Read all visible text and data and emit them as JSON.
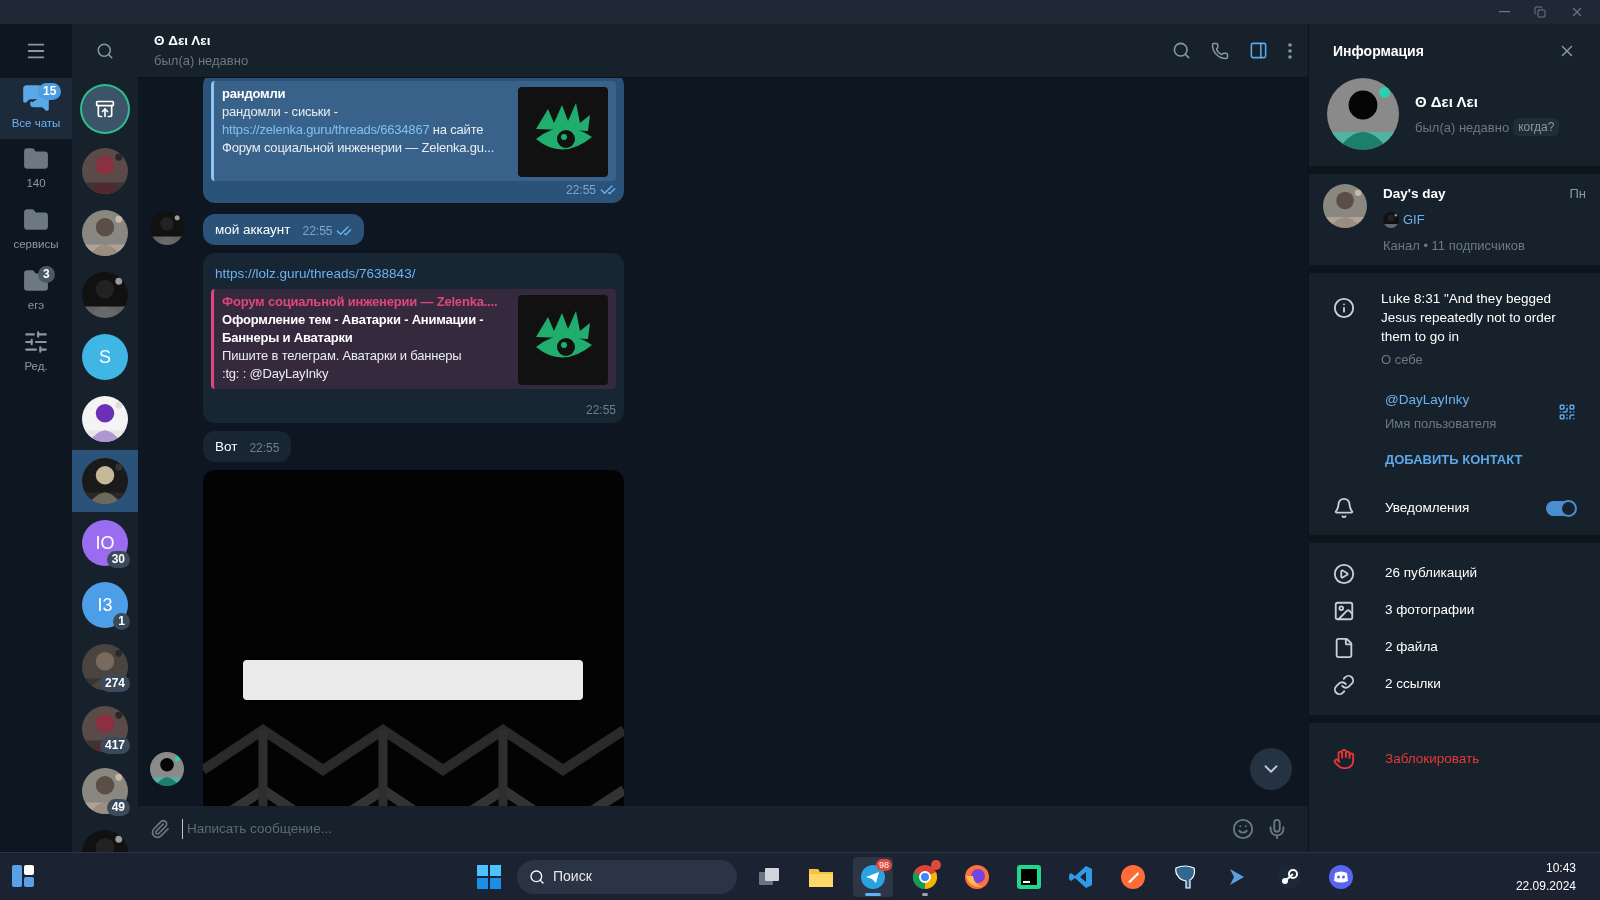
{
  "folders": [
    {
      "kind": "chats",
      "label": "Все чаты",
      "badge": "15",
      "selected": true
    },
    {
      "kind": "folder",
      "label": "140",
      "selected": false
    },
    {
      "kind": "folder",
      "label": "сервисы",
      "selected": false
    },
    {
      "kind": "folder",
      "label": "егэ",
      "badge": "3",
      "selected": false
    },
    {
      "kind": "edit",
      "label": "Ред.",
      "selected": false
    }
  ],
  "chats": [
    {
      "kind": "archive",
      "selected": false
    },
    {
      "kind": "picture",
      "selected": false
    },
    {
      "kind": "picture",
      "selected": false
    },
    {
      "kind": "picture",
      "selected": false
    },
    {
      "kind": "letter",
      "letter": "S",
      "color": "#3fb6e3",
      "selected": false
    },
    {
      "kind": "picture",
      "selected": false
    },
    {
      "kind": "picture",
      "selected": true
    },
    {
      "kind": "letter",
      "letter": "IO",
      "color": "#9a6cf0",
      "badge": "30",
      "selected": false
    },
    {
      "kind": "letter",
      "letter": "I3",
      "color": "#4c9ee8",
      "badge": "1",
      "selected": false
    },
    {
      "kind": "picture",
      "badge": "274",
      "selected": false
    },
    {
      "kind": "picture",
      "badge": "417",
      "selected": false
    },
    {
      "kind": "picture",
      "badge": "49",
      "selected": false
    },
    {
      "kind": "picture",
      "selected": false
    }
  ],
  "header": {
    "name": "ʘ Δει Λει",
    "status": "был(а) недавно"
  },
  "messages": [
    {
      "kind": "preview",
      "outgoing": true,
      "preview": {
        "color": "#8cc4f2",
        "title": "рандомли",
        "before": "рандомли - сиськи - ",
        "link": "https://zelenka.guru/threads/6634867",
        "after": " на сайте Форум социальной инженерии —  Zelenka.gu..."
      },
      "time": "22:55",
      "read": true
    },
    {
      "kind": "text",
      "outgoing": true,
      "avatar": true,
      "text": "мой аккаунт",
      "time": "22:55",
      "read": true
    },
    {
      "kind": "link",
      "outgoing": false,
      "link": "https://lolz.guru/threads/7638843/",
      "preview": {
        "color": "#e0467a",
        "site": "Форум социальной инженерии —  Zelenka....",
        "title": "Оформление тем - Аватарки - Анимации - Баннеры и Аватарки",
        "before": "Пишите в телеграм. Аватарки и баннеры\n:tg: : @DayLayInky"
      },
      "time": "22:55"
    },
    {
      "kind": "text",
      "outgoing": false,
      "text": "Вот",
      "time": "22:55"
    },
    {
      "kind": "gif",
      "outgoing": false,
      "avatar": true
    }
  ],
  "composer": {
    "placeholder": "Написать сообщение..."
  },
  "info": {
    "title": "Информация",
    "name": "ʘ Δει Λει",
    "status": "был(а) недавно",
    "status_chip": "когда?",
    "channel": {
      "name": "Day's day",
      "day": "Пн",
      "last": "GIF",
      "meta": "Канал • 11 подписчиков"
    },
    "bio": "Luke 8:31 \"And they begged Jesus repeatedly not to order them to go in",
    "bio_label": "О себе",
    "username": "@DayLayInky",
    "username_label": "Имя пользователя",
    "add_contact": "ДОБАВИТЬ КОНТАКТ",
    "notifications": {
      "label": "Уведомления",
      "on": true
    },
    "media": [
      {
        "kind": "posts",
        "label": "26 публикаций"
      },
      {
        "kind": "photos",
        "label": "3 фотографии"
      },
      {
        "kind": "files",
        "label": "2 файла"
      },
      {
        "kind": "links",
        "label": "2 ссылки"
      }
    ],
    "block": "Заблокировать"
  },
  "taskbar": {
    "search": "Поиск",
    "apps": [
      {
        "kind": "taskview",
        "running": false,
        "selected": false
      },
      {
        "kind": "explorer",
        "running": false,
        "selected": false
      },
      {
        "kind": "telegram",
        "badge": "98",
        "running": true,
        "selected": true
      },
      {
        "kind": "chrome",
        "alert": true,
        "running": true,
        "selected": false
      },
      {
        "kind": "firefox",
        "running": false,
        "selected": false
      },
      {
        "kind": "pycharm",
        "running": false,
        "selected": false
      },
      {
        "kind": "vscode",
        "running": false,
        "selected": false
      },
      {
        "kind": "postman",
        "running": false,
        "selected": false
      },
      {
        "kind": "postgres",
        "running": false,
        "selected": false
      },
      {
        "kind": "terminal",
        "running": false,
        "selected": false
      },
      {
        "kind": "steam",
        "running": false,
        "selected": false
      },
      {
        "kind": "discord",
        "running": false,
        "selected": false
      }
    ],
    "time": "10:43",
    "date": "22.09.2024"
  }
}
